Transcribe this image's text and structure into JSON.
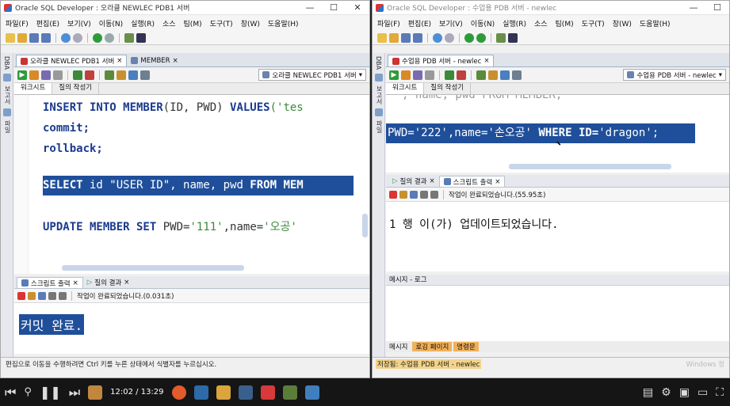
{
  "menu": [
    "파일(F)",
    "편집(E)",
    "보기(V)",
    "이동(N)",
    "실행(R)",
    "소스",
    "팀(M)",
    "도구(T)",
    "창(W)",
    "도움말(H)"
  ],
  "left": {
    "title": "Oracle SQL Developer : 오라클 NEWLEC PDB1 서버",
    "tabs": [
      "오라클 NEWLEC PDB1 서버",
      "MEMBER"
    ],
    "connection": "오라클 NEWLEC PDB1 서버",
    "subtabs": [
      "워크시트",
      "질의 작성기"
    ],
    "sidebar": [
      "DBA",
      "보고서",
      "파일"
    ],
    "code": {
      "l1a": "INSERT INTO MEMBER",
      "l1b": "(ID, PWD) ",
      "l1c": "VALUES",
      "l1d": "('tes",
      "l2": "commit;",
      "l3": "rollback;",
      "l4a": "SELECT",
      "l4b": " id \"USER ID\", name, pwd ",
      "l4c": "FROM MEM",
      "l5a": "UPDATE MEMBER SET",
      "l5b": " PWD=",
      "l5c": "'111'",
      "l5d": ",name=",
      "l5e": "'오공'"
    },
    "panel_tabs": [
      "스크립트 출력",
      "질의 결과"
    ],
    "panel_status": "작업이 완료되었습니다.(0.031초)",
    "output": "커밋 완료.",
    "status": "편집으로 이동을 수행하려면 Ctrl 키를 누른 상태에서 식별자를 누르십시오."
  },
  "right": {
    "title": "Oracle SQL Developer : 수업용 PDB 서버 - newlec",
    "tabs": [
      "수업용 PDB 서버 - newlec"
    ],
    "connection": "수업용 PDB 서버 - newlec",
    "subtabs": [
      "워크시트",
      "질의 작성기"
    ],
    "sidebar": [
      "DBA",
      "보고서",
      "파일"
    ],
    "code": {
      "l0": ", name, pwd FROM MEMBER;",
      "l1a": "PWD=",
      "l1b": "'222'",
      "l1c": ",name=",
      "l1d": "'손오공'",
      "l1e": " WHERE ID=",
      "l1f": "'dragon'",
      "l1g": ";"
    },
    "panel_tabs": [
      "질의 결과",
      "스크립트 출력"
    ],
    "panel_status": "작업이 완료되었습니다.(55.95초)",
    "output": "1 행 이(가) 업데이트되었습니다.",
    "log_title": "메시지 - 로그",
    "log_tabs": [
      "메시지",
      "로깅 페이지",
      "명령문"
    ],
    "status": "저장됨: 수업용 PDB 서버 - newlec",
    "status_right": "Windows 정"
  },
  "video": {
    "time": "12:02 / 13:29",
    "progress": 0.887
  }
}
